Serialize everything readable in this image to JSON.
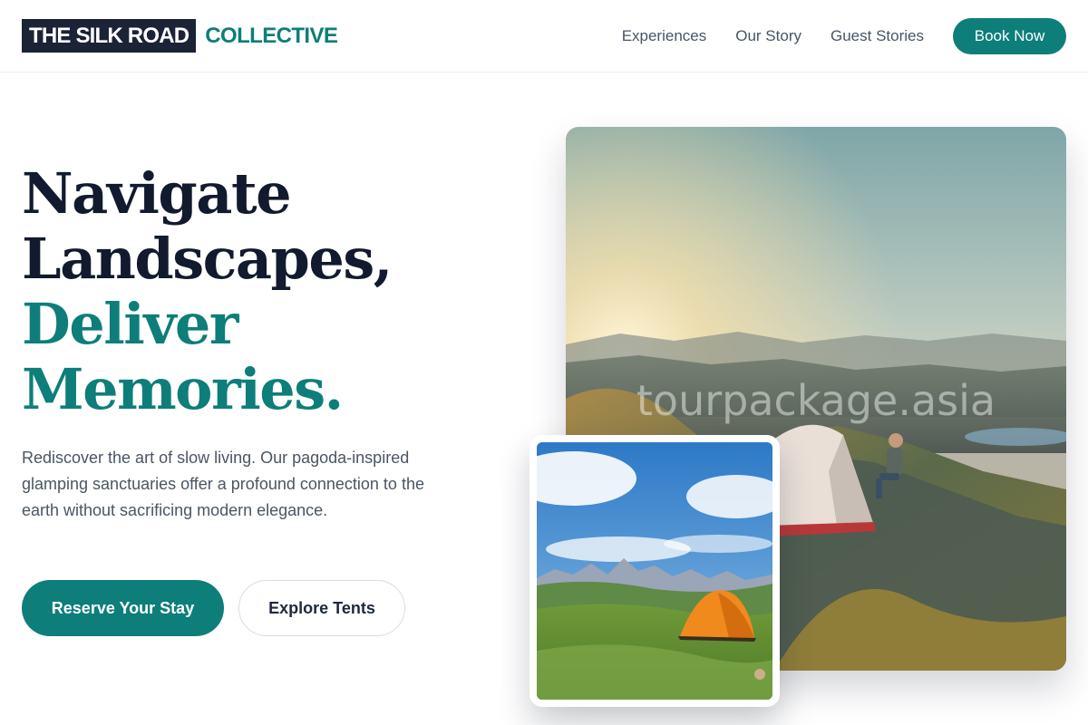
{
  "header": {
    "logo_box": "THE SILK ROAD",
    "logo_accent": "COLLECTIVE",
    "nav": [
      "Experiences",
      "Our Story",
      "Guest Stories"
    ],
    "cta": "Book Now"
  },
  "hero": {
    "headline_line1": "Navigate",
    "headline_line2": "Landscapes,",
    "headline_line3": "Deliver",
    "headline_line4": "Memories.",
    "lead": "Rediscover the art of slow living. Our pagoda-inspired glamping sanctuaries offer a profound connection to the earth without sacrificing modern elegance.",
    "primary_button": "Reserve Your Stay",
    "secondary_button": "Explore Tents"
  },
  "images": {
    "main_watermark": "tourpackage.asia"
  },
  "colors": {
    "brand_dark": "#1b2336",
    "accent_teal": "#0d7e7a"
  }
}
